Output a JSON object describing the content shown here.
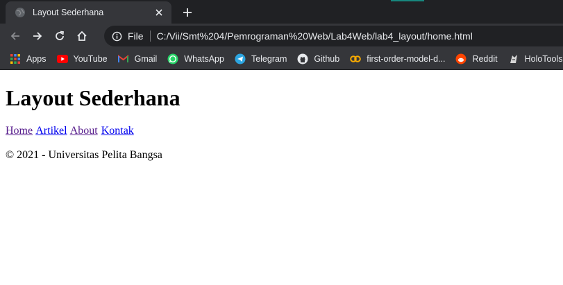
{
  "browser": {
    "tab": {
      "title": "Layout Sederhana"
    },
    "toolbar": {
      "file_label": "File",
      "url": "C:/Vii/Smt%204/Pemrograman%20Web/Lab4Web/lab4_layout/home.html"
    },
    "bookmarks": [
      {
        "label": "Apps",
        "icon": "apps-grid-icon"
      },
      {
        "label": "YouTube",
        "icon": "youtube-icon"
      },
      {
        "label": "Gmail",
        "icon": "gmail-icon"
      },
      {
        "label": "WhatsApp",
        "icon": "whatsapp-icon"
      },
      {
        "label": "Telegram",
        "icon": "telegram-icon"
      },
      {
        "label": "Github",
        "icon": "github-icon"
      },
      {
        "label": "first-order-model-d...",
        "icon": "colab-icon"
      },
      {
        "label": "Reddit",
        "icon": "reddit-icon"
      },
      {
        "label": "HoloTools",
        "icon": "holotools-icon"
      }
    ]
  },
  "page": {
    "heading": "Layout Sederhana",
    "nav": [
      {
        "label": "Home"
      },
      {
        "label": "Artikel"
      },
      {
        "label": "About"
      },
      {
        "label": "Kontak"
      }
    ],
    "footer": "© 2021 - Universitas Pelita Bangsa"
  },
  "colors": {
    "chrome_dark": "#202124",
    "chrome_light": "#35363a",
    "chrome_text": "#e8eaed",
    "link_visited": "#551a8b",
    "link_unvisited": "#0000ee"
  }
}
